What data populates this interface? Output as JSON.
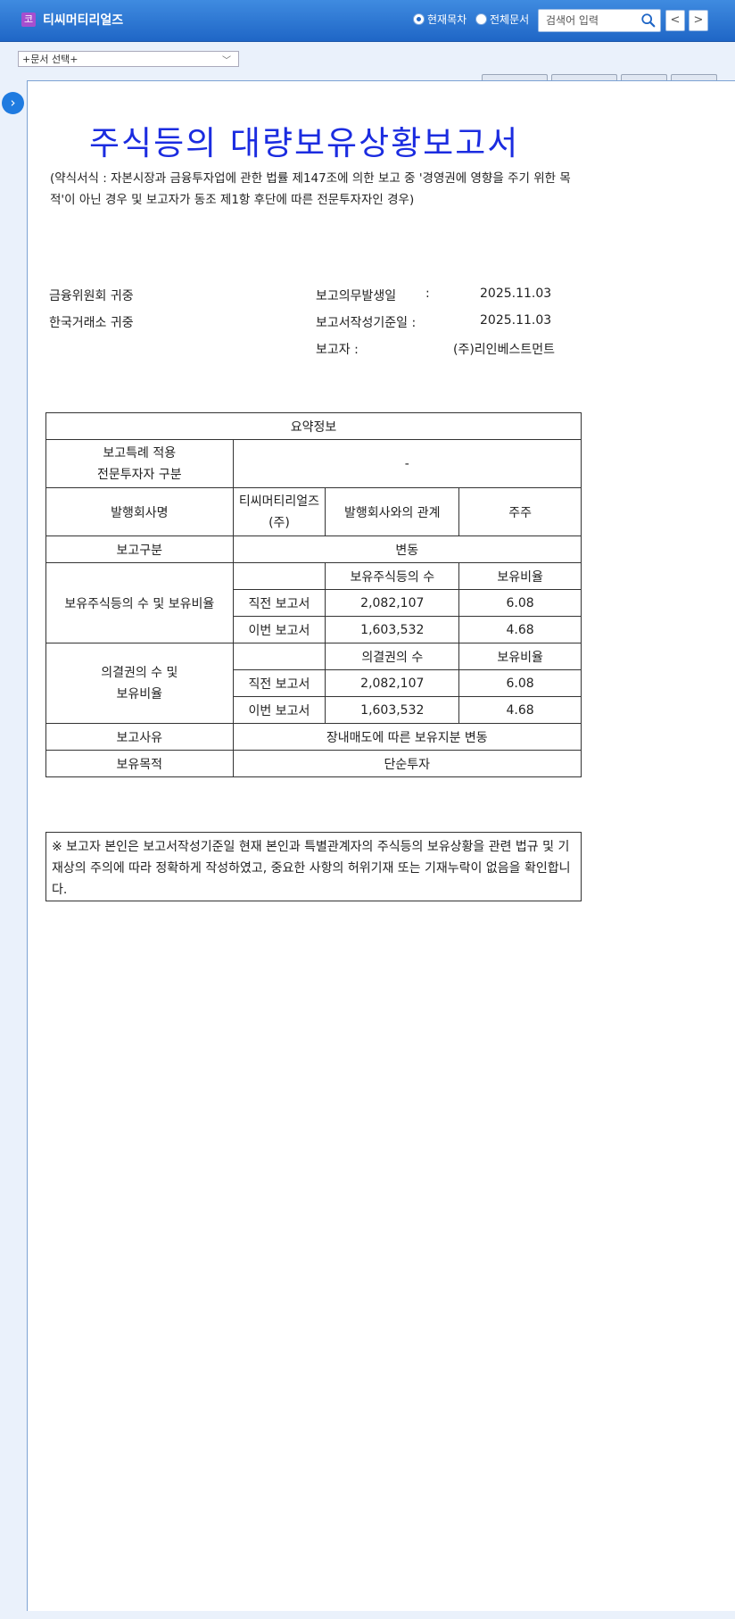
{
  "header": {
    "logo_char": "코",
    "company": "티씨머티리얼즈",
    "scope_current": "현재목차",
    "scope_all": "전체문서",
    "search_placeholder": "검색어 입력",
    "prev": "<",
    "next": ">"
  },
  "doc_select": {
    "selected": "+문서 선택+"
  },
  "sidebar_toggle": "›",
  "document": {
    "title": "주식등의 대량보유상황보고서",
    "subtitle": "(약식서식 : 자본시장과 금융투자업에 관한 법률 제147조에 의한 보고 중 '경영권에 영향을 주기 위한 목적'이 아닌 경우 및 보고자가 동조 제1항 후단에 따른 전문투자자인 경우)",
    "addressee1": "금융위원회 귀중",
    "addressee2": "한국거래소 귀중",
    "obligation_date_label": "보고의무발생일",
    "obligation_date_colon": ":",
    "obligation_date": "2025.11.03",
    "base_date_label": "보고서작성기준일 :",
    "base_date": "2025.11.03",
    "reporter_label": "보고자 :",
    "reporter": "(주)리인베스트먼트"
  },
  "summary": {
    "heading": "요약정보",
    "special_label_1": "보고특례 적용",
    "special_label_2": "전문투자자 구분",
    "special_value": "-",
    "issuer_label": "발행회사명",
    "issuer_value": "티씨머티리얼즈(주)",
    "relation_label": "발행회사와의 관계",
    "relation_value": "주주",
    "report_type_label": "보고구분",
    "report_type_value": "변동",
    "shares_label": "보유주식등의 수 및 보유비율",
    "shares_col_count": "보유주식등의 수",
    "shares_col_ratio": "보유비율",
    "previous_label": "직전 보고서",
    "current_label": "이번 보고서",
    "shares_prev_count": "2,082,107",
    "shares_prev_ratio": "6.08",
    "shares_curr_count": "1,603,532",
    "shares_curr_ratio": "4.68",
    "votes_label_1": "의결권의 수 및",
    "votes_label_2": "보유비율",
    "votes_col_count": "의결권의 수",
    "votes_col_ratio": "보유비율",
    "votes_prev_count": "2,082,107",
    "votes_prev_ratio": "6.08",
    "votes_curr_count": "1,603,532",
    "votes_curr_ratio": "4.68",
    "reason_label": "보고사유",
    "reason_value": "장내매도에 따른 보유지분 변동",
    "purpose_label": "보유목적",
    "purpose_value": "단순투자"
  },
  "note": "※ 보고자 본인은 보고서작성기준일 현재 본인과 특별관계자의 주식등의 보유상황을 관련 법규 및 기재상의 주의에 따라 정확하게 작성하였고, 중요한 사항의 허위기재 또는 기재누락이 없음을 확인합니다."
}
